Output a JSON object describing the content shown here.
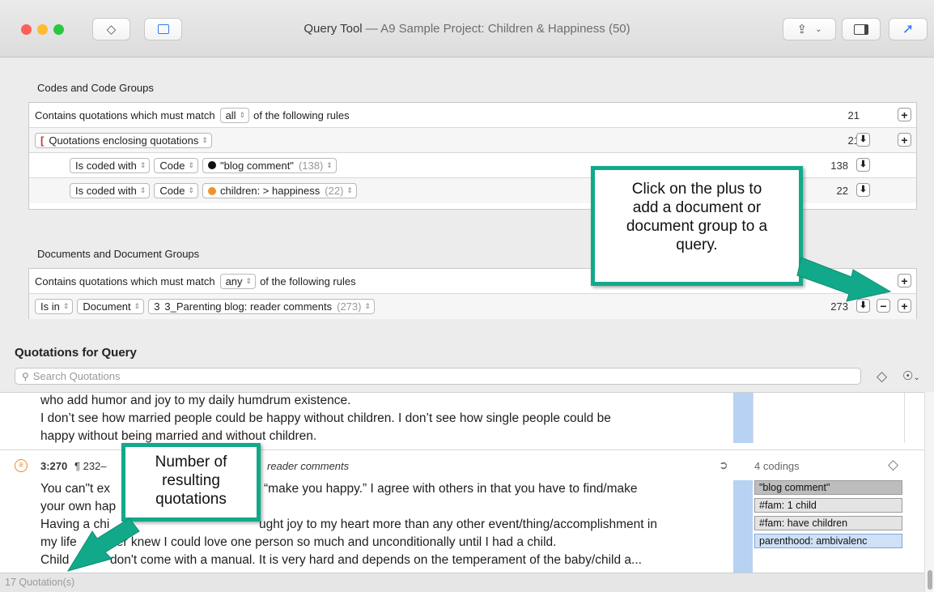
{
  "window": {
    "title_main": "Query Tool",
    "title_sub": "— A9 Sample Project: Children & Happiness (50)"
  },
  "colors": {
    "accent": "#12a98a",
    "selection_blue": "#b7d2f3",
    "pin_blue": "#2f7cf6"
  },
  "codes_section": {
    "label": "Codes and Code Groups",
    "match_prefix": "Contains quotations which must match",
    "match_value": "all",
    "match_suffix": "of the following rules",
    "match_count": "21",
    "operator_label": "Quotations enclosing quotations",
    "operator_count": "21",
    "rules": [
      {
        "condition": "Is coded with",
        "type": "Code",
        "code": "\"blog comment\"",
        "code_count": "(138)",
        "code_color": "#111111",
        "count": "138"
      },
      {
        "condition": "Is coded with",
        "type": "Code",
        "code": "children: > happiness",
        "code_count": "(22)",
        "code_color": "#f0932b",
        "count": "22"
      }
    ]
  },
  "documents_section": {
    "label": "Documents and Document Groups",
    "match_prefix": "Contains quotations which must match",
    "match_value": "any",
    "match_suffix": "of the following rules",
    "match_count": "273",
    "rule": {
      "condition": "Is in",
      "type": "Document",
      "doc_number": "3",
      "doc_name": "3_Parenting blog: reader comments",
      "doc_count": "(273)",
      "count": "273"
    }
  },
  "quotations": {
    "heading": "Quotations for Query",
    "search_placeholder": "Search Quotations",
    "first_item_lines": [
      "who add humor and joy to my daily humdrum existence.",
      "I don’t see how married people could be happy without children. I don’t see how single people could be",
      "happy without being married and without children."
    ],
    "second_item": {
      "id": "3:270",
      "location": "¶ 232–",
      "doc": "reader comments",
      "codings_label": "4 codings",
      "lines": [
        "You can\"t ex",
        "“make you happy.” I agree with others in that you have to find/make",
        "your own hap",
        "Having a chi",
        "ught joy to my heart more than any other event/thing/accomplishment in",
        "my life",
        "ver knew I could love one person so much and unconditionally until I had a child.",
        "Child",
        "don't come with a manual. It is very hard and depends on the temperament of the baby/child a..."
      ],
      "codes": [
        "\"blog comment\"",
        "#fam: 1 child",
        "#fam: have children",
        "parenthood: ambivalenc"
      ]
    },
    "status": "17 Quotation(s)"
  },
  "callouts": {
    "plus_tip": [
      "Click on the plus to",
      "add a document or",
      "document group to a",
      "query."
    ],
    "count_tip": [
      "Number of",
      "resulting",
      "quotations"
    ]
  }
}
